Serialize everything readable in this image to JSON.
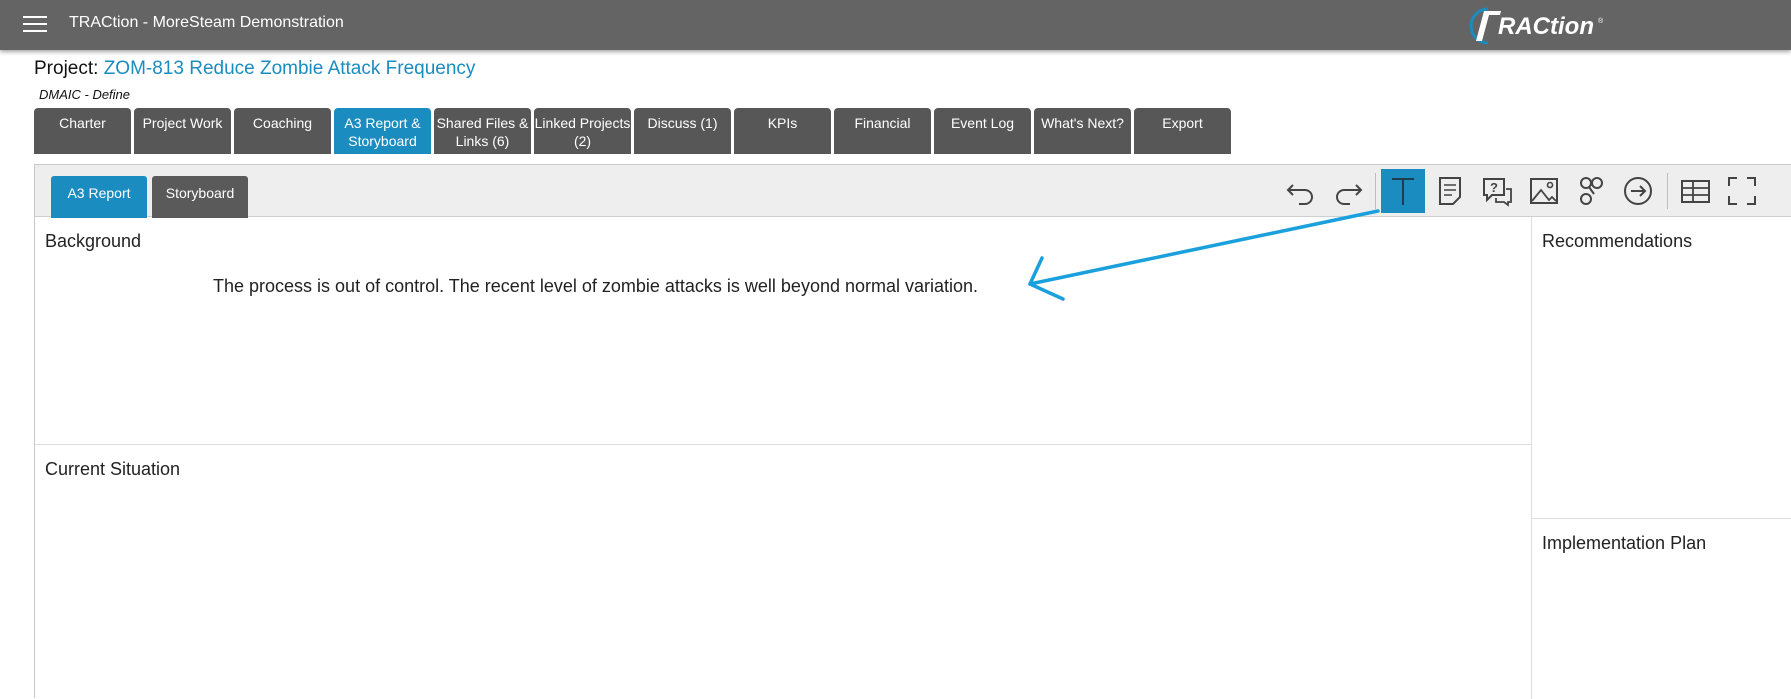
{
  "header": {
    "app_title": "TRACtion - MoreSteam Demonstration",
    "logo_text": "TRACtion",
    "menu_icon": "hamburger-menu-icon"
  },
  "project": {
    "label": "Project:",
    "name": "ZOM-813 Reduce Zombie Attack Frequency",
    "phase": "DMAIC - Define"
  },
  "tabs": [
    {
      "label": "Charter"
    },
    {
      "label": "Project Work"
    },
    {
      "label": "Coaching"
    },
    {
      "label": "A3 Report & Storyboard",
      "active": true
    },
    {
      "label": "Shared Files & Links (6)"
    },
    {
      "label": "Linked Projects (2)"
    },
    {
      "label": "Discuss (1)"
    },
    {
      "label": "KPIs"
    },
    {
      "label": "Financial"
    },
    {
      "label": "Event Log"
    },
    {
      "label": "What's Next?"
    },
    {
      "label": "Export"
    }
  ],
  "subtabs": [
    {
      "label": "A3 Report",
      "active": true
    },
    {
      "label": "Storyboard"
    }
  ],
  "toolbar_icons": [
    "undo-icon",
    "redo-icon",
    "text-tool-icon",
    "note-icon",
    "question-comment-icon",
    "image-icon",
    "shapes-icon",
    "arrow-circle-icon",
    "table-layout-icon",
    "fullscreen-icon"
  ],
  "sections": {
    "background": {
      "title": "Background",
      "text": "The process is out of control.  The recent level of zombie attacks is well beyond normal variation."
    },
    "current_situation": {
      "title": "Current Situation"
    },
    "recommendations": {
      "title": "Recommendations"
    },
    "implementation_plan": {
      "title": "Implementation Plan"
    }
  },
  "colors": {
    "topbar": "#646464",
    "accent": "#1a8cc0",
    "tab": "#575757"
  }
}
